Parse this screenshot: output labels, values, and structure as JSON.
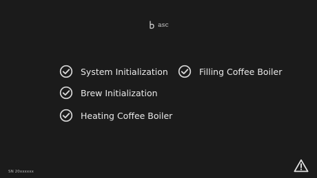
{
  "header": {
    "brand_text": "asc",
    "brand_icon": "brand-logo-icon"
  },
  "status": {
    "items": [
      {
        "label": "System Initialization",
        "icon": "check-circle-icon",
        "state": "done"
      },
      {
        "label": "Brew Initialization",
        "icon": "check-circle-icon",
        "state": "done"
      },
      {
        "label": "Heating Coffee Boiler",
        "icon": "check-circle-icon",
        "state": "done"
      },
      {
        "label": "Filling Coffee Boiler",
        "icon": "check-circle-icon",
        "state": "done"
      }
    ]
  },
  "footer": {
    "serial_text": "SN 20xxxxxx",
    "warning_icon": "warning-icon"
  },
  "colors": {
    "background": "#1b1b1b",
    "text": "#eaeaea",
    "icon": "#d8d8d8"
  }
}
